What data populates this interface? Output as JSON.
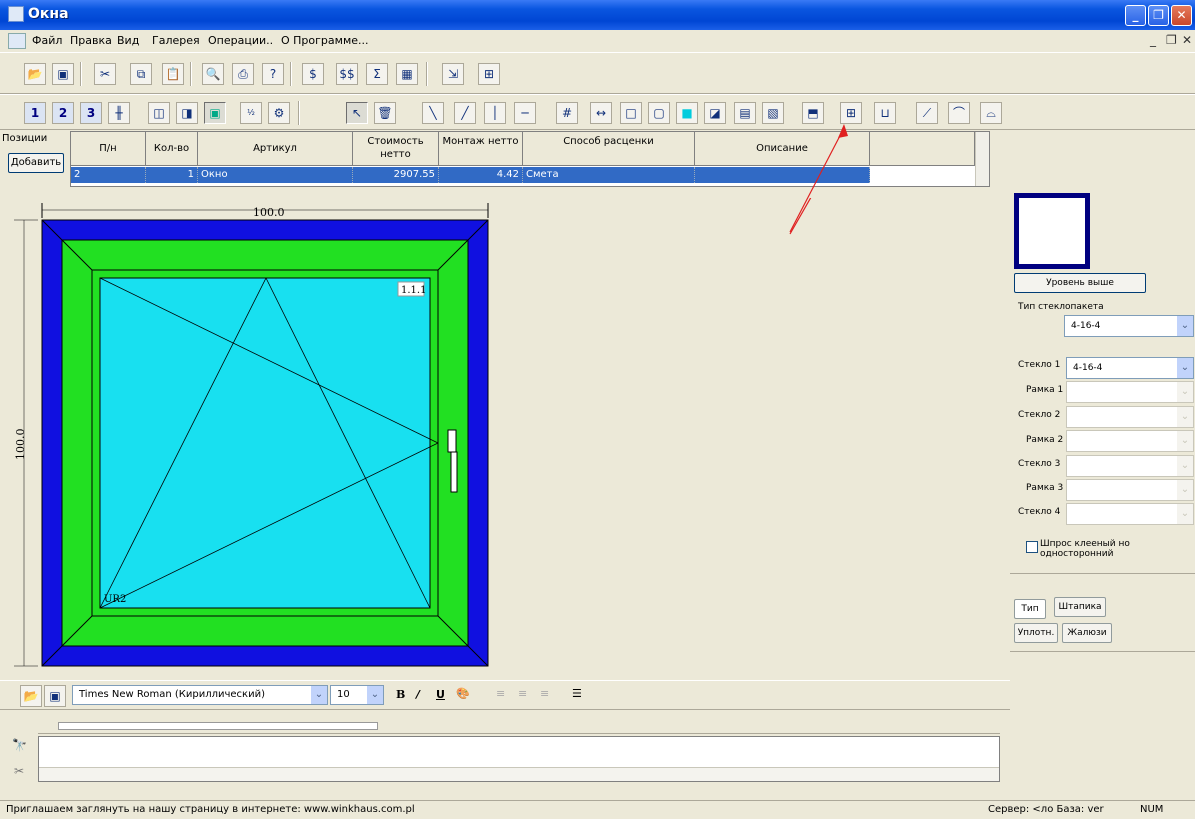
{
  "window": {
    "title": "Окна"
  },
  "menu": {
    "items": [
      "Файл",
      "Правка",
      "Вид",
      "Галерея",
      "Операции..",
      "О Программе..."
    ]
  },
  "grid": {
    "side_labels": {
      "positions": "Позиции",
      "add_button": "Добавить"
    },
    "headers": [
      "П/н",
      "Кол-во",
      "Артикул",
      "Стоимость нетто",
      "Монтаж нетто",
      "Способ расценки",
      "Описание"
    ],
    "row": {
      "pn": "2",
      "qty": "1",
      "article": "Окно",
      "cost": "2907.55",
      "mount": "4.42",
      "pricing": "Смета",
      "desc": ""
    }
  },
  "drawing": {
    "width_label": "100.0",
    "height_label": "100.0",
    "sash_id": "1.1.1",
    "handle_id": "UR2",
    "colors": {
      "outer_frame": "#1010e0",
      "frame": "#22e022",
      "glass": "#18e0f0"
    }
  },
  "right_panel": {
    "level_up_button": "Уровень выше",
    "glass_unit_type_label": "Тип стеклопакета",
    "glass_unit_type_value": "4-16-4",
    "fields": [
      {
        "label": "Стекло 1",
        "value": "4-16-4"
      },
      {
        "label": "Рамка 1",
        "value": ""
      },
      {
        "label": "Стекло 2",
        "value": ""
      },
      {
        "label": "Рамка 2",
        "value": ""
      },
      {
        "label": "Стекло 3",
        "value": ""
      },
      {
        "label": "Рамка 3",
        "value": ""
      },
      {
        "label": "Стекло 4",
        "value": ""
      }
    ],
    "checkbox_label": "Шпрос клееный но односторонний",
    "tabs": [
      "Тип",
      "Штапика",
      "Уплотн.",
      "Жалюзи"
    ]
  },
  "format_toolbar": {
    "font": "Times New Roman (Кириллический)",
    "size": "10"
  },
  "status": {
    "message": "Приглашаем заглянуть на нашу страницу в интернете: www.winkhaus.com.pl",
    "server": "Сервер: <ло База: ver",
    "num": "NUM"
  }
}
